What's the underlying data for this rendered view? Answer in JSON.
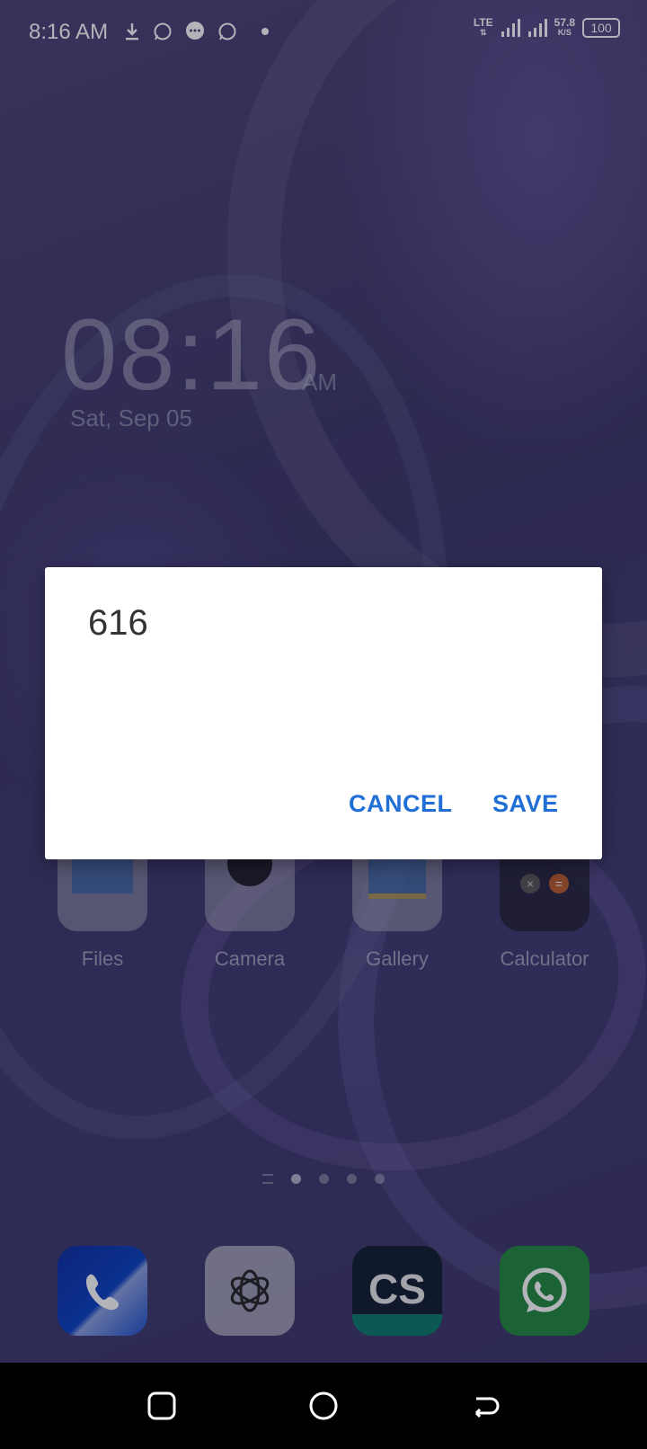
{
  "status_bar": {
    "time": "8:16 AM",
    "net_type": "LTE",
    "speed_value": "57.8",
    "speed_unit": "K/S",
    "battery": "100",
    "icons": [
      "download-icon",
      "whatsapp-icon",
      "message-icon",
      "whatsapp-icon",
      "dot-icon",
      "signal-icon",
      "signal-icon"
    ]
  },
  "clock_widget": {
    "time": "08:16",
    "ampm": "AM",
    "date": "Sat, Sep 05"
  },
  "apps": [
    {
      "label": "Files"
    },
    {
      "label": "Camera"
    },
    {
      "label": "Gallery"
    },
    {
      "label": "Calculator"
    }
  ],
  "dock": [
    "phone-icon",
    "chatgpt-icon",
    "camscanner-icon",
    "whatsapp-icon"
  ],
  "dialog": {
    "value": "616",
    "cancel_label": "CANCEL",
    "save_label": "SAVE"
  },
  "colors": {
    "accent": "#1f6fd6",
    "navbar": "#000000"
  }
}
